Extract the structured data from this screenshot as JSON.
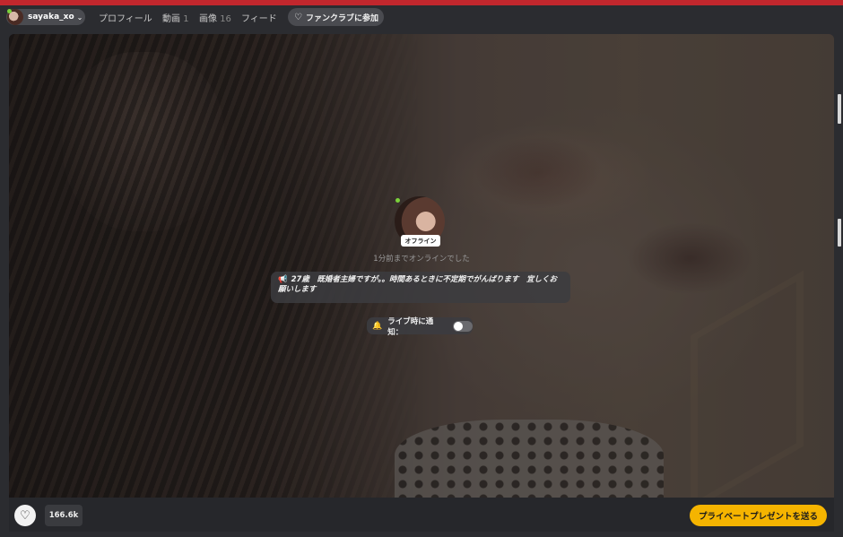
{
  "header": {
    "username": "sayaka_xo",
    "nav": [
      {
        "label": "プロフィール",
        "count": ""
      },
      {
        "label": "動画",
        "count": "1"
      },
      {
        "label": "画像",
        "count": "16"
      },
      {
        "label": "フィード",
        "count": ""
      }
    ],
    "fanclub_label": "ファンクラブに参加"
  },
  "stage": {
    "status_badge": "オフライン",
    "last_seen": "1分前までオンラインでした",
    "bio": "27歳　既婚者主婦ですが。。時間あるときに不定期でがんばります　宜しくお願いします",
    "notify_label": "ライブ時に通知：",
    "notify_enabled": false
  },
  "footer": {
    "likes": "166.6k",
    "gift_label": "プライベートプレゼントを送る"
  },
  "colors": {
    "accent_red": "#c1272d",
    "gift_yellow": "#f5b400",
    "online_green": "#7bd23b"
  },
  "icons": {
    "fanclub": "heart-icon",
    "bio": "megaphone-icon",
    "notify": "bell-icon",
    "like": "heart-outline-icon"
  }
}
